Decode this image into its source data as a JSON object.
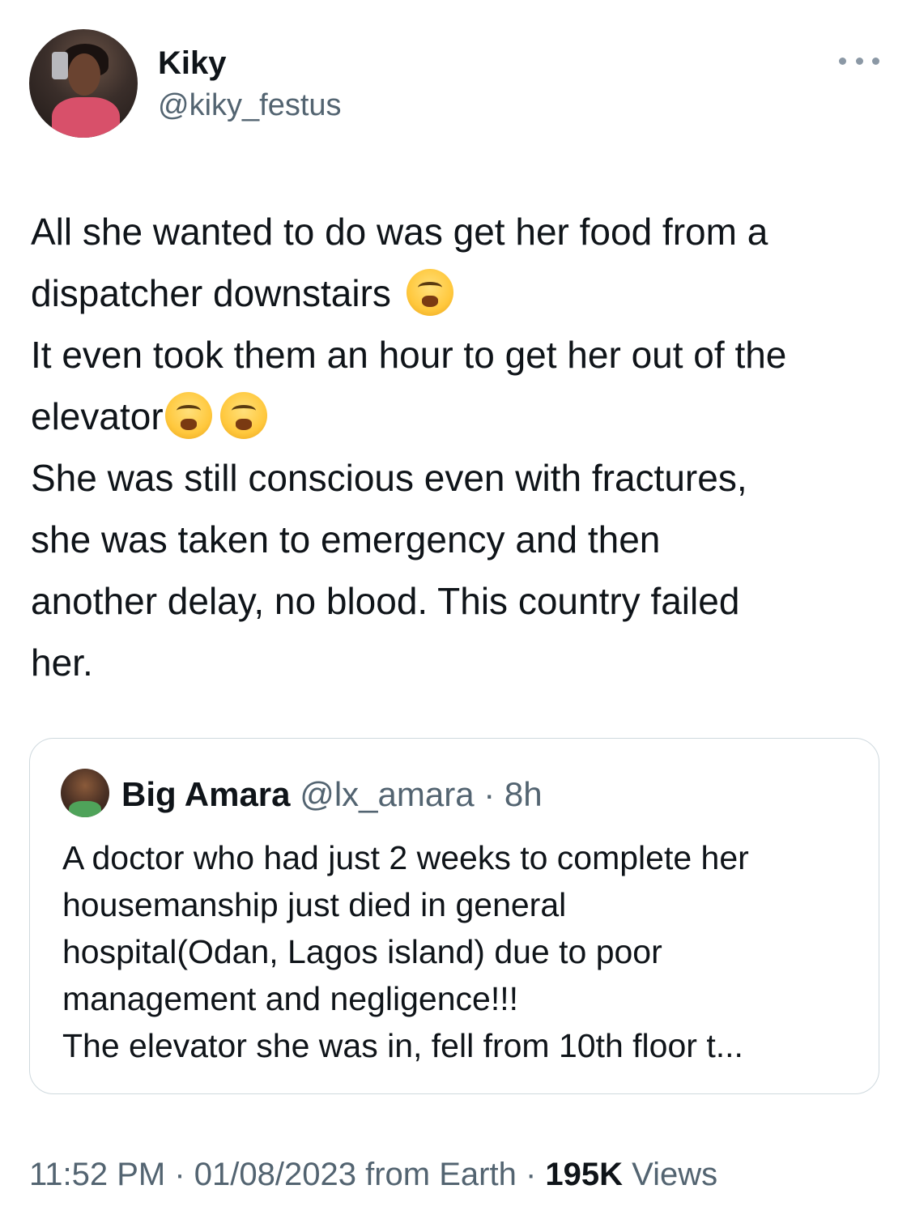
{
  "author": {
    "name": "Kiky",
    "handle": "@kiky_festus"
  },
  "tweet": {
    "lines": [
      "All she wanted to do was get her food from a",
      "dispatcher downstairs ",
      "It even took them an hour to get her out of the",
      "elevator",
      "She was still conscious even with fractures,",
      "she was taken to emergency and then",
      "another delay, no blood. This country failed",
      "her."
    ],
    "emoji": "weary-face"
  },
  "quoted": {
    "name": "Big Amara",
    "handle": "@lx_amara",
    "separator": "·",
    "time": "8h",
    "lines": [
      "A doctor who had just 2 weeks to complete her",
      "housemanship just died in general",
      "hospital(Odan, Lagos island) due to poor",
      "management and negligence!!!",
      "The elevator she was in, fell from 10th floor t..."
    ]
  },
  "meta": {
    "time": "11:52 PM",
    "sep1": " · ",
    "date": "01/08/2023",
    "source": " from Earth",
    "sep2": " · ",
    "views_count": "195K",
    "views_label": " Views"
  },
  "colors": {
    "text": "#0f1419",
    "secondary": "#536471",
    "border": "#cfd9de"
  }
}
